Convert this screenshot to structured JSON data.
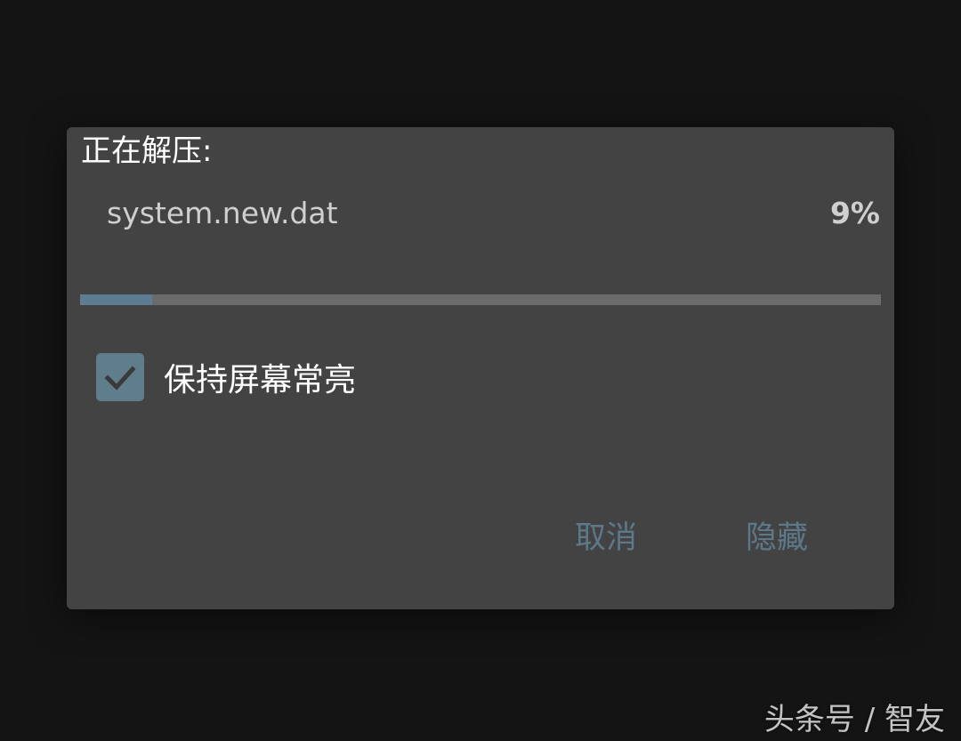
{
  "dialog": {
    "title": "正在解压:",
    "file_name": "system.new.dat",
    "percent_text": "9%",
    "progress": 0.09,
    "keep_screen_on": {
      "label": "保持屏幕常亮",
      "checked": true,
      "icon": "check-icon"
    },
    "buttons": {
      "cancel_label": "取消",
      "hide_label": "隐藏"
    }
  },
  "watermark": "头条号 / 智友",
  "colors": {
    "background": "#141414",
    "dialog": "#434343",
    "accent": "#607d8b",
    "button_text": "#5d7888",
    "progress_track": "#6b6b6b",
    "progress_fill": "#5f7d92"
  }
}
